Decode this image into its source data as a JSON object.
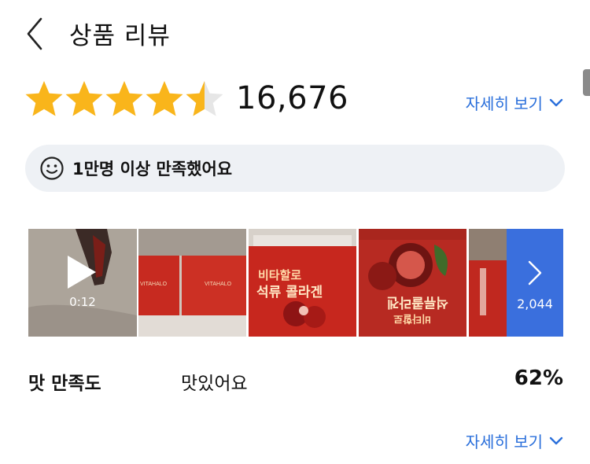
{
  "header": {
    "title": "상품 리뷰"
  },
  "rating": {
    "stars": 4.5,
    "count": "16,676",
    "detail_label": "자세히 보기"
  },
  "satisfaction": {
    "text": "1만명 이상 만족했어요"
  },
  "media": {
    "video_duration": "0:12",
    "more_count": "2,044",
    "photo3_text": "비타할로\n석류 콜라겐",
    "photo4_text": "비타할로\n석류 콜라겐",
    "box_brand": "VITAHALO"
  },
  "taste": {
    "label": "맛 만족도",
    "value": "맛있어요",
    "percent": "62%"
  },
  "footer": {
    "detail_label": "자세히 보기"
  },
  "colors": {
    "star": "#f9b51b",
    "star_empty": "#e6e6e6",
    "link": "#2a6fdb",
    "pill_bg": "#eef1f5",
    "more_overlay": "#3a6fdd",
    "product_red": "#c8281f"
  },
  "icons": {
    "back": "back-chevron-icon",
    "star": "star-icon",
    "smile": "smile-icon",
    "play": "play-icon",
    "next": "chevron-right-icon",
    "expand": "chevron-down-icon"
  }
}
